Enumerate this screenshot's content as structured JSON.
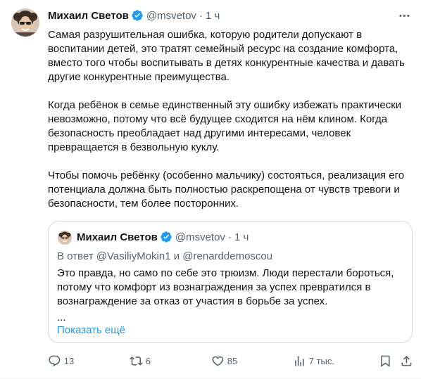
{
  "author": {
    "name": "Михаил Светов",
    "handle": "@msvetov",
    "separator": "·",
    "time": "1 ч"
  },
  "tweet": {
    "paragraphs": [
      "Самая разрушительная ошибка, которую родители допускают в воспитании детей, это тратят семейный ресурс на создание комфорта, вместо того чтобы воспитывать в детях конкурентные качества и давать другие конкурентные преимущества.",
      "Когда ребёнок в семье единственный эту ошибку избежать практически невозможно, потому что всё будущее сходится на нём клином. Когда безопасность преобладает над другими интересами, человек превращается в безвольную куклу.",
      "Чтобы помочь ребёнку (особенно мальчику) состояться, реализация его потенциала должна быть полностью раскрепощена от чувств тревоги и безопасности, тем более посторонних."
    ]
  },
  "quote": {
    "name": "Михаил Светов",
    "handle": "@msvetov",
    "separator": "·",
    "time": "1 ч",
    "reply_prefix": "В ответ ",
    "reply_user1": "@VasiliyMokin1",
    "reply_and": " и ",
    "reply_user2": "@renarddemoscou",
    "text": "Это правда, но само по себе это трюизм. Люди перестали бороться, потому что комфорт из вознаграждения за успех превратился в вознаграждение за отказ от участия в борьбе за успех.",
    "ellipsis": "...",
    "show_more": "Показать ещё"
  },
  "actions": {
    "replies": "13",
    "retweets": "6",
    "likes": "85",
    "views": "7 тыс."
  },
  "colors": {
    "text": "#0f1419",
    "muted": "#536471",
    "accent": "#1d9bf0",
    "border": "#cfd9de"
  },
  "icons": [
    "more-icon",
    "verified-badge-icon",
    "reply-icon",
    "retweet-icon",
    "like-icon",
    "views-icon",
    "bookmark-icon",
    "share-icon"
  ]
}
